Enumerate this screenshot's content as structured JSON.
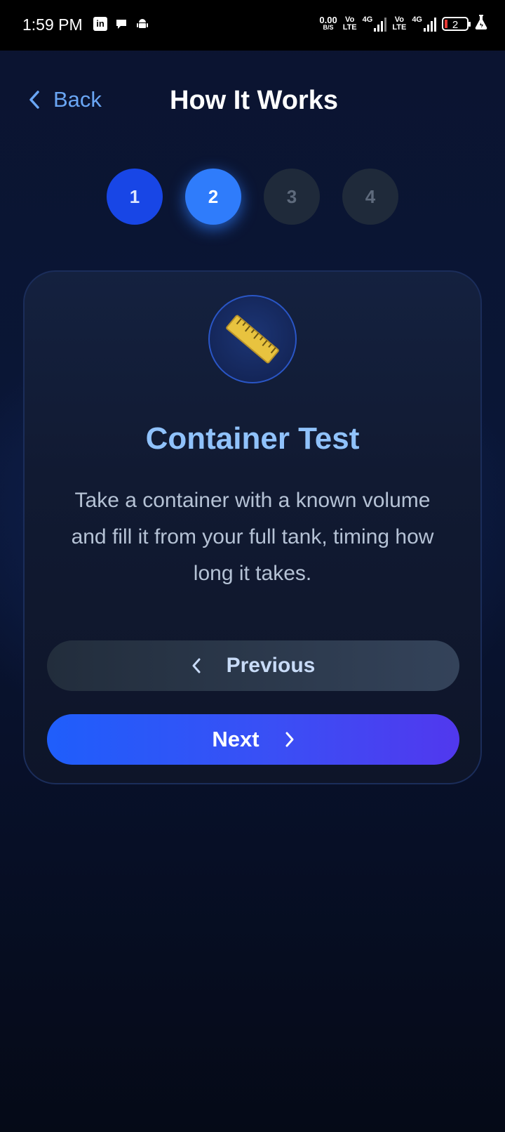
{
  "status_bar": {
    "time": "1:59 PM",
    "notification_icons": [
      "linkedin-icon",
      "chat-bubble-icon",
      "android-icon"
    ],
    "net_speed_value": "0.00",
    "net_speed_unit": "B/S",
    "volte_1_top": "Vo",
    "volte_1_bottom": "LTE",
    "volte_2_top": "Vo",
    "volte_2_bottom": "LTE",
    "network_1": "4G",
    "network_2": "4G",
    "battery_level": "2"
  },
  "header": {
    "back_label": "Back",
    "title": "How It Works"
  },
  "stepper": {
    "steps": [
      {
        "label": "1",
        "state": "completed"
      },
      {
        "label": "2",
        "state": "current"
      },
      {
        "label": "3",
        "state": "upcoming"
      },
      {
        "label": "4",
        "state": "upcoming"
      }
    ]
  },
  "card": {
    "icon": "ruler-icon",
    "title": "Container Test",
    "description": "Take a container with a known volume and fill it from your full tank, timing how long it takes.",
    "previous_label": "Previous",
    "next_label": "Next"
  },
  "colors": {
    "accent": "#2f7cfb",
    "title_blue": "#90c2fb",
    "back_blue": "#6aa6f5",
    "next_gradient_start": "#1f5efb",
    "next_gradient_end": "#5138ee"
  }
}
